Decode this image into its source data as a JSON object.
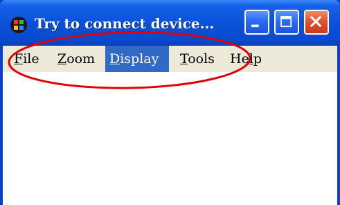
{
  "window": {
    "title": "Try to connect device...",
    "icon": "app-grid-icon",
    "controls": {
      "minimize": "minimize-icon",
      "maximize": "maximize-icon",
      "close": "close-icon"
    }
  },
  "menubar": {
    "items": [
      {
        "accel": "F",
        "rest": "ile"
      },
      {
        "accel": "Z",
        "rest": "oom"
      },
      {
        "accel": "D",
        "rest": "isplay",
        "selected": true
      },
      {
        "accel": "T",
        "rest": "ools"
      },
      {
        "pre": "He",
        "accel": "l",
        "rest": "p"
      }
    ]
  },
  "colors": {
    "titlebar": "#0b52d9",
    "menubar": "#ece9d8",
    "selection": "#316ac5",
    "close_button": "#e2552d",
    "annotation": "#e00000"
  },
  "annotation": {
    "shape": "ellipse",
    "target": "menubar"
  }
}
